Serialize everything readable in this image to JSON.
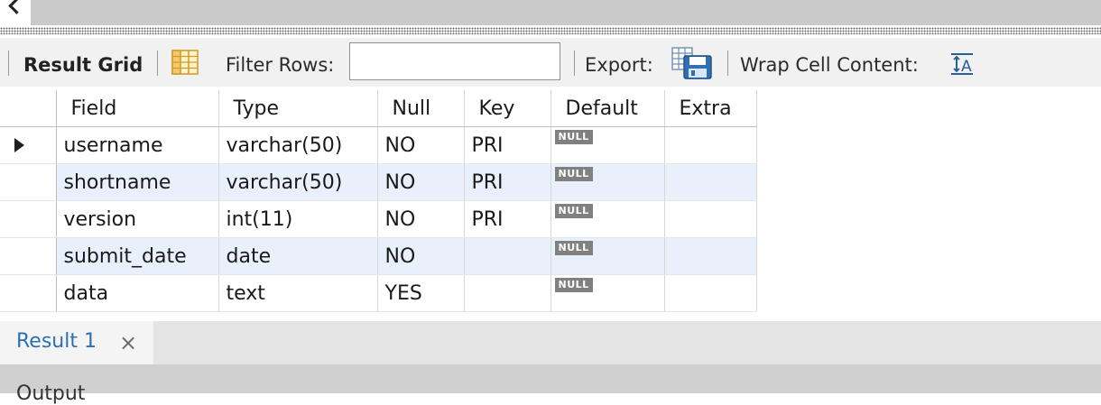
{
  "toolbar": {
    "result_grid_label": "Result Grid",
    "filter_rows_label": "Filter Rows:",
    "filter_rows_value": "",
    "export_label": "Export:",
    "wrap_label": "Wrap Cell Content:"
  },
  "grid": {
    "columns": [
      "Field",
      "Type",
      "Null",
      "Key",
      "Default",
      "Extra"
    ],
    "null_badge": "NULL",
    "rows": [
      {
        "field": "username",
        "type": "varchar(50)",
        "null": "NO",
        "key": "PRI",
        "default": "NULL",
        "extra": ""
      },
      {
        "field": "shortname",
        "type": "varchar(50)",
        "null": "NO",
        "key": "PRI",
        "default": "NULL",
        "extra": ""
      },
      {
        "field": "version",
        "type": "int(11)",
        "null": "NO",
        "key": "PRI",
        "default": "NULL",
        "extra": ""
      },
      {
        "field": "submit_date",
        "type": "date",
        "null": "NO",
        "key": "",
        "default": "NULL",
        "extra": ""
      },
      {
        "field": "data",
        "type": "text",
        "null": "YES",
        "key": "",
        "default": "NULL",
        "extra": ""
      }
    ]
  },
  "tabs": {
    "result_tab_label": "Result 1",
    "close_glyph": "×",
    "output_label": "Output"
  },
  "icons": {
    "back": "chevron-left-icon",
    "grid": "grid-view-icon",
    "export": "export-save-icon",
    "wrap": "wrap-text-icon"
  },
  "colors": {
    "alt_row": "#e8f0fb",
    "tab_active_text": "#2d6fb4",
    "null_badge": "#808080"
  }
}
